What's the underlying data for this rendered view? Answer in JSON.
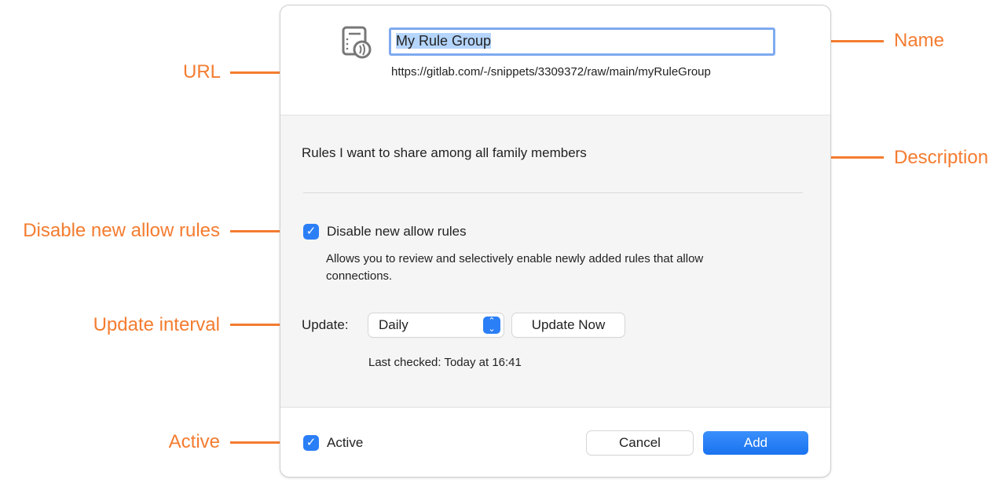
{
  "annotations": {
    "name": "Name",
    "url": "URL",
    "description": "Description",
    "disable_new_allow_rules": "Disable new allow rules",
    "update_interval": "Update interval",
    "active": "Active"
  },
  "accent_color": "#f47c30",
  "dialog": {
    "icon": "rule-group-subscription-icon",
    "name_value": "My Rule Group",
    "url": "https://gitlab.com/-/snippets/3309372/raw/main/myRuleGroup",
    "description": "Rules I want to share among all family members",
    "disable_new_allow_rules": {
      "label": "Disable new allow rules",
      "checked": true,
      "help": "Allows you to review and selectively enable newly added rules that allow connections."
    },
    "update": {
      "label": "Update:",
      "selected": "Daily",
      "update_now": "Update Now",
      "last_checked": "Last checked: Today at 16:41"
    },
    "active": {
      "label": "Active",
      "checked": true
    },
    "cancel": "Cancel",
    "add": "Add"
  }
}
